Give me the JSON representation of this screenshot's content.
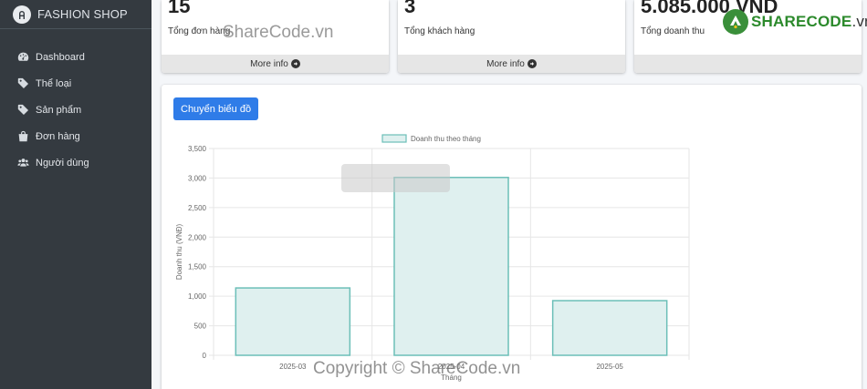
{
  "brand": {
    "name": "FASHION SHOP"
  },
  "sidebar": {
    "items": [
      {
        "label": "Dashboard",
        "icon": "dashboard-icon"
      },
      {
        "label": "Thể loại",
        "icon": "tag-icon"
      },
      {
        "label": "Sản phẩm",
        "icon": "tag-icon"
      },
      {
        "label": "Đơn hàng",
        "icon": "shopping-bag-icon"
      },
      {
        "label": "Người dùng",
        "icon": "users-icon"
      }
    ]
  },
  "cards": [
    {
      "value": "15",
      "label": "Tổng đơn hàng",
      "more": "More info"
    },
    {
      "value": "3",
      "label": "Tổng khách hàng",
      "more": "More info"
    },
    {
      "value": "5.085.000 VND",
      "label": "Tổng doanh thu",
      "more": ""
    }
  ],
  "watermark": {
    "logo_brand": "SHARECODE",
    "logo_domain": ".vn",
    "top": "ShareCode.vn",
    "bottom": "Copyright © ShareCode.vn"
  },
  "chart_panel": {
    "toggle_button": "Chuyển biểu đồ"
  },
  "colors": {
    "bar_fill": "#dff0ef",
    "bar_border": "#6cbfb8",
    "primary": "#2f7ce8",
    "sidebar": "#343a40"
  },
  "chart_data": {
    "type": "bar",
    "categories": [
      "2025-03",
      "2025-04",
      "2025-05"
    ],
    "series": [
      {
        "name": "Doanh thu theo tháng",
        "values": [
          1140,
          3010,
          925
        ]
      }
    ],
    "title": "",
    "xlabel": "Tháng",
    "ylabel": "Doanh thu (VNĐ)",
    "ylim": [
      0,
      3500
    ],
    "yticks": [
      "0",
      "500",
      "1,000",
      "1,500",
      "2,000",
      "2,500",
      "3,000",
      "3,500"
    ],
    "grid": true,
    "legend": "top"
  }
}
